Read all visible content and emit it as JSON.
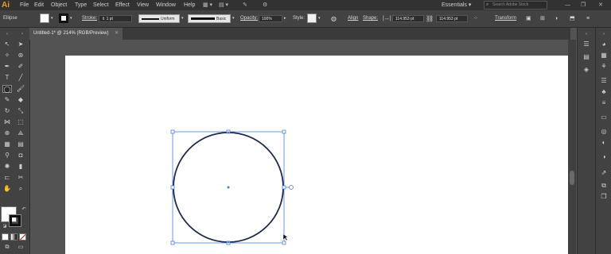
{
  "app": {
    "logo": "Ai"
  },
  "menu": [
    "File",
    "Edit",
    "Object",
    "Type",
    "Select",
    "Effect",
    "View",
    "Window",
    "Help"
  ],
  "workspace": {
    "label": "Essentials",
    "search_placeholder": "Search Adobe Stock"
  },
  "control_bar": {
    "selection_label": "Ellipse",
    "stroke_label": "Stroke:",
    "stroke_weight": "1 pt",
    "variable_width": "Uniform",
    "brush": "Basic",
    "opacity_label": "Opacity:",
    "opacity_value": "100%",
    "style_label": "Style:",
    "align_label": "Align",
    "shape_label": "Shape:",
    "width_value": "114.953 pt",
    "height_value": "114.953 pt",
    "transform_label": "Transform"
  },
  "document": {
    "tab_title": "Untitled-1* @ 214% (RGB/Preview)"
  },
  "colors": {
    "selection": "#4f7fd8",
    "circle_stroke": "#1f2a4d",
    "artboard": "#ffffff",
    "accent": "#f29a1c"
  }
}
